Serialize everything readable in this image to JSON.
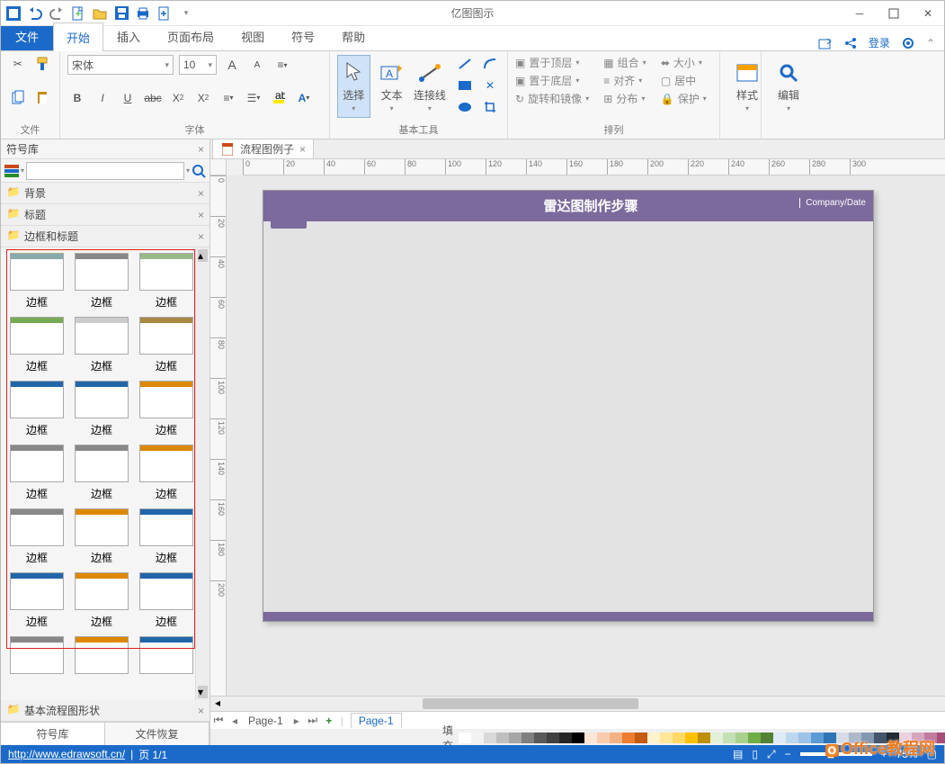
{
  "app": {
    "title": "亿图图示"
  },
  "ribbon": {
    "file": "文件",
    "tabs": [
      "开始",
      "插入",
      "页面布局",
      "视图",
      "符号",
      "帮助"
    ],
    "active_tab": 0,
    "right": {
      "login": "登录"
    },
    "groups": {
      "file": "文件",
      "font": {
        "label": "字体",
        "name": "宋体",
        "size": "10"
      },
      "basic": {
        "label": "基本工具",
        "select": "选择",
        "text": "文本",
        "connector": "连接线"
      },
      "arrange": {
        "label": "排列",
        "items": [
          "置于顶层",
          "组合",
          "大小",
          "置于底层",
          "对齐",
          "居中",
          "旋转和镜像",
          "分布",
          "保护"
        ]
      },
      "style": "样式",
      "edit": "编辑"
    }
  },
  "left": {
    "title": "符号库",
    "cats": [
      "背景",
      "标题",
      "边框和标题"
    ],
    "item_label": "边框",
    "bottom_cat": "基本流程图形状",
    "tabs": [
      "符号库",
      "文件恢复"
    ]
  },
  "doc": {
    "tab": "流程图例子",
    "page_title": "雷达图制作步骤",
    "company": "Company/Date"
  },
  "ruler_h": [
    "0",
    "20",
    "40",
    "60",
    "80",
    "100",
    "120",
    "140",
    "160",
    "180",
    "200",
    "220",
    "240",
    "260",
    "280",
    "300"
  ],
  "ruler_v": [
    "0",
    "20",
    "40",
    "60",
    "80",
    "100",
    "120",
    "140",
    "160",
    "180",
    "200"
  ],
  "bottom": {
    "page_label": "Page-1",
    "page_tab": "Page-1",
    "fill_label": "填充"
  },
  "status": {
    "url": "http://www.edrawsoft.cn/",
    "page": "页 1/1",
    "zoom": "75%"
  },
  "watermark": "Office教程网",
  "colors": {
    "swatches": [
      "#ffffff",
      "#f2f2f2",
      "#d9d9d9",
      "#bfbfbf",
      "#a6a6a6",
      "#7f7f7f",
      "#595959",
      "#404040",
      "#262626",
      "#000000",
      "#fbe5d6",
      "#f8cbad",
      "#f4b183",
      "#ed7d31",
      "#c55a11",
      "#fff2cc",
      "#ffe699",
      "#ffd966",
      "#ffc000",
      "#bf9000",
      "#e2f0d9",
      "#c5e0b4",
      "#a9d18e",
      "#70ad47",
      "#548235",
      "#deebf7",
      "#bdd7ee",
      "#9dc3e6",
      "#5b9bd5",
      "#2e75b6",
      "#d6dce5",
      "#adb9ca",
      "#8497b0",
      "#44546a",
      "#222a35",
      "#e8d1dc",
      "#d5a6bd",
      "#c27ba0",
      "#a64d79",
      "#741b47",
      "#7030a0",
      "#002060",
      "#c00000",
      "#ff0000"
    ]
  }
}
